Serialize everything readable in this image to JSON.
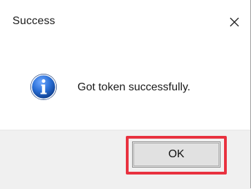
{
  "window": {
    "title": "Success",
    "close_icon": "close-icon"
  },
  "content": {
    "icon": "info-icon",
    "icon_color": "#1b5fb8",
    "message": "Got token successfully."
  },
  "footer": {
    "ok_label": "OK",
    "highlight_color": "#e8313f"
  }
}
